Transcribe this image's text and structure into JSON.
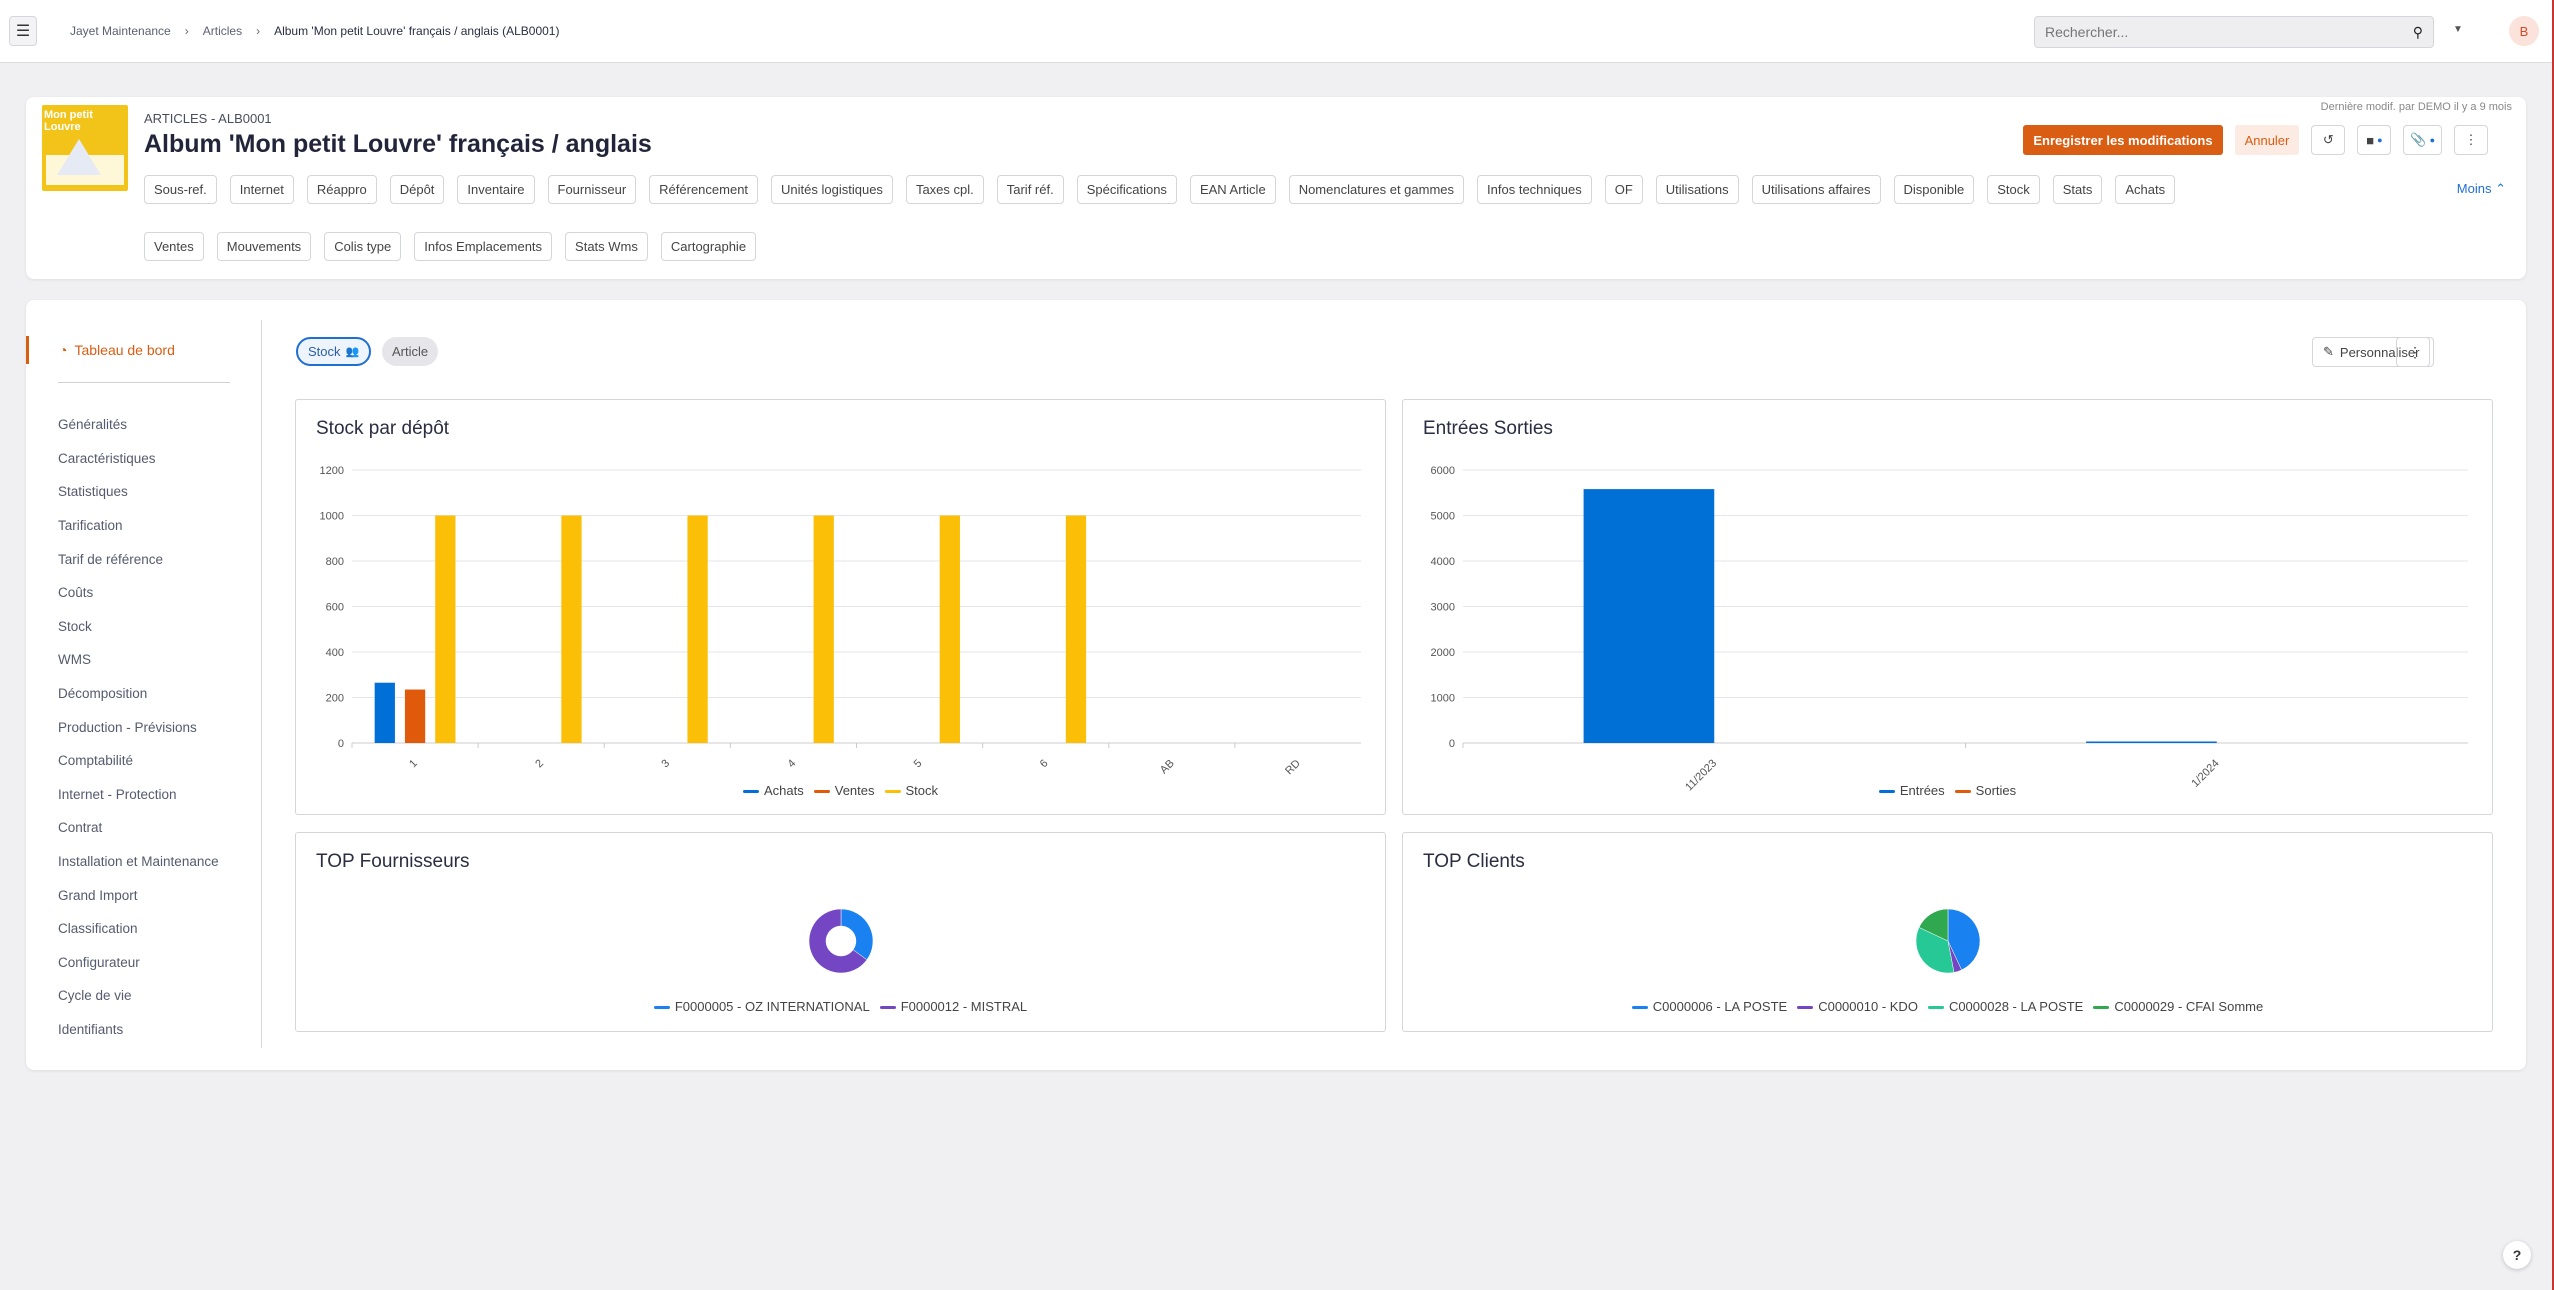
{
  "topbar": {
    "menu_icon": "hamburger-icon",
    "breadcrumb": [
      "Jayet Maintenance",
      "Articles",
      "Album 'Mon petit Louvre' français / anglais (ALB0001)"
    ],
    "search_placeholder": "Rechercher...",
    "avatar_initial": "B"
  },
  "header": {
    "thumbnail_text": "Mon petit Louvre",
    "subtitle": "ARTICLES - ALB0001",
    "title": "Album 'Mon petit Louvre' français / anglais",
    "last_modified": "Dernière modif. par DEMO il y a 9 mois",
    "save_label": "Enregistrer les modifications",
    "cancel_label": "Annuler",
    "tabs": [
      "Sous-ref.",
      "Internet",
      "Réappro",
      "Dépôt",
      "Inventaire",
      "Fournisseur",
      "Référencement",
      "Unités logistiques",
      "Taxes cpl.",
      "Tarif réf.",
      "Spécifications",
      "EAN Article",
      "Nomenclatures et gammes",
      "Infos techniques",
      "OF",
      "Utilisations",
      "Utilisations affaires",
      "Disponible",
      "Stock",
      "Stats",
      "Achats",
      "Ventes",
      "Mouvements",
      "Colis type",
      "Infos Emplacements",
      "Stats Wms",
      "Cartographie"
    ],
    "less_label": "Moins"
  },
  "sidebar": {
    "active": "Tableau de bord",
    "items": [
      "Généralités",
      "Caractéristiques",
      "Statistiques",
      "Tarification",
      "Tarif de référence",
      "Coûts",
      "Stock",
      "WMS",
      "Décomposition",
      "Production - Prévisions",
      "Comptabilité",
      "Internet - Protection",
      "Contrat",
      "Installation et Maintenance",
      "Grand Import",
      "Classification",
      "Configurateur",
      "Cycle de vie",
      "Identifiants"
    ]
  },
  "dashboard": {
    "pills": [
      "Stock",
      "Article"
    ],
    "customize_label": "Personnaliser"
  },
  "colors": {
    "accent": "#d95d12",
    "blue": "#006fd6",
    "orange": "#e05a0c",
    "yellow": "#fbbf08",
    "purple": "#7446c4",
    "teal": "#26c996",
    "green": "#2fa84f",
    "lightblue": "#1a82f0"
  },
  "chart_data": [
    {
      "type": "bar",
      "title": "Stock par dépôt",
      "categories": [
        "1",
        "2",
        "3",
        "4",
        "5",
        "6",
        "AB",
        "RD"
      ],
      "series": [
        {
          "name": "Achats",
          "color": "#006fd6",
          "values": [
            265,
            0,
            0,
            0,
            0,
            0,
            0,
            0
          ]
        },
        {
          "name": "Ventes",
          "color": "#e05a0c",
          "values": [
            235,
            0,
            0,
            0,
            0,
            0,
            0,
            0
          ]
        },
        {
          "name": "Stock",
          "color": "#fbbf08",
          "values": [
            1000,
            1000,
            1000,
            1000,
            1000,
            1000,
            0,
            0
          ]
        }
      ],
      "yticks": [
        0,
        200,
        400,
        600,
        800,
        1000,
        1200
      ],
      "ylim": [
        0,
        1200
      ],
      "grid": true,
      "legend": "bottom"
    },
    {
      "type": "bar",
      "title": "Entrées Sorties",
      "categories": [
        "11/2023",
        "1/2024"
      ],
      "series": [
        {
          "name": "Entrées",
          "color": "#006fd6",
          "values": [
            5580,
            20
          ]
        },
        {
          "name": "Sorties",
          "color": "#e05a0c",
          "values": [
            0,
            0
          ]
        }
      ],
      "yticks": [
        0,
        1000,
        2000,
        3000,
        4000,
        5000,
        6000
      ],
      "ylim": [
        0,
        6000
      ],
      "grid": true,
      "legend": "bottom"
    },
    {
      "type": "pie",
      "title": "TOP Fournisseurs",
      "donut": true,
      "slices": [
        {
          "label": "F0000005 - OZ INTERNATIONAL",
          "value": 35,
          "color": "#1a82f0"
        },
        {
          "label": "F0000012 - MISTRAL",
          "value": 65,
          "color": "#7446c4"
        }
      ],
      "legend": "bottom"
    },
    {
      "type": "pie",
      "title": "TOP Clients",
      "donut": false,
      "slices": [
        {
          "label": "C0000006 - LA POSTE",
          "value": 43,
          "color": "#1a82f0"
        },
        {
          "label": "C0000010 - KDO",
          "value": 4,
          "color": "#7446c4"
        },
        {
          "label": "C0000028 - LA POSTE",
          "value": 35,
          "color": "#26c996"
        },
        {
          "label": "C0000029 - CFAI Somme",
          "value": 18,
          "color": "#2fa84f"
        }
      ],
      "legend": "bottom"
    }
  ]
}
